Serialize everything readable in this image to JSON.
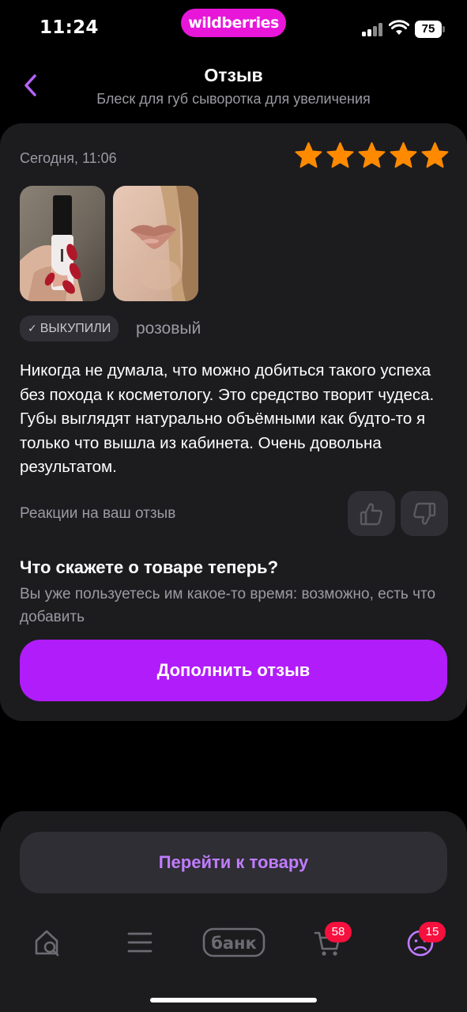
{
  "status_bar": {
    "time": "11:24",
    "brand": "wildberries",
    "battery": "75",
    "signal_icon": "cellular-signal-icon",
    "wifi_icon": "wifi-icon"
  },
  "header": {
    "back_icon": "chevron-left-icon",
    "title": "Отзыв",
    "subtitle": "Блеск для губ сыворотка для увеличения"
  },
  "review": {
    "date": "Сегодня, 11:06",
    "rating": 5,
    "rating_max": 5,
    "photos": [
      "photo-lip-gloss-in-hand",
      "photo-lips"
    ],
    "badge": "ВЫКУПИЛИ",
    "variant": "розовый",
    "text": "Никогда не думала, что можно добиться такого успеха без похода к косметологу. Это средство творит чудеса. Губы выглядят натурально объёмными как будто-то я только что вышла из кабинета. Очень довольна результатом.",
    "reactions_label": "Реакции на ваш отзыв"
  },
  "prompt": {
    "title": "Что скажете о товаре теперь?",
    "text": "Вы уже пользуетесь им какое-то время: возможно, есть что добавить",
    "button": "Дополнить отзыв"
  },
  "go_to_product": "Перейти к товару",
  "tab_bar": {
    "bank_label": "банк",
    "cart_count": "58",
    "profile_count": "15"
  },
  "colors": {
    "accent": "#b11dfa",
    "brand": "#e816d9",
    "star": "#ff8a00",
    "badge": "#f5103e",
    "link": "#c17cff"
  }
}
